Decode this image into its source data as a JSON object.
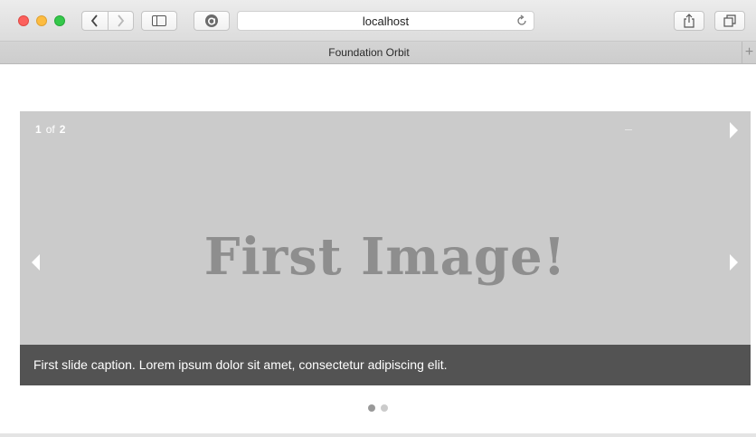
{
  "browser": {
    "address": "localhost",
    "tab_title": "Foundation Orbit",
    "new_tab_label": "+"
  },
  "orbit": {
    "slide_number": {
      "current": "1",
      "of_label": "of",
      "total": "2"
    },
    "slide_image_text": "First Image!",
    "caption": "First slide caption. Lorem ipsum dolor sit amet, consectetur adipiscing elit.",
    "bullets": [
      {
        "active": true
      },
      {
        "active": false
      }
    ]
  },
  "colors": {
    "slide_background": "#cbcbcb",
    "caption_background": "#535353",
    "bullet_active": "#999999",
    "bullet_inactive": "#cbcbcb"
  }
}
